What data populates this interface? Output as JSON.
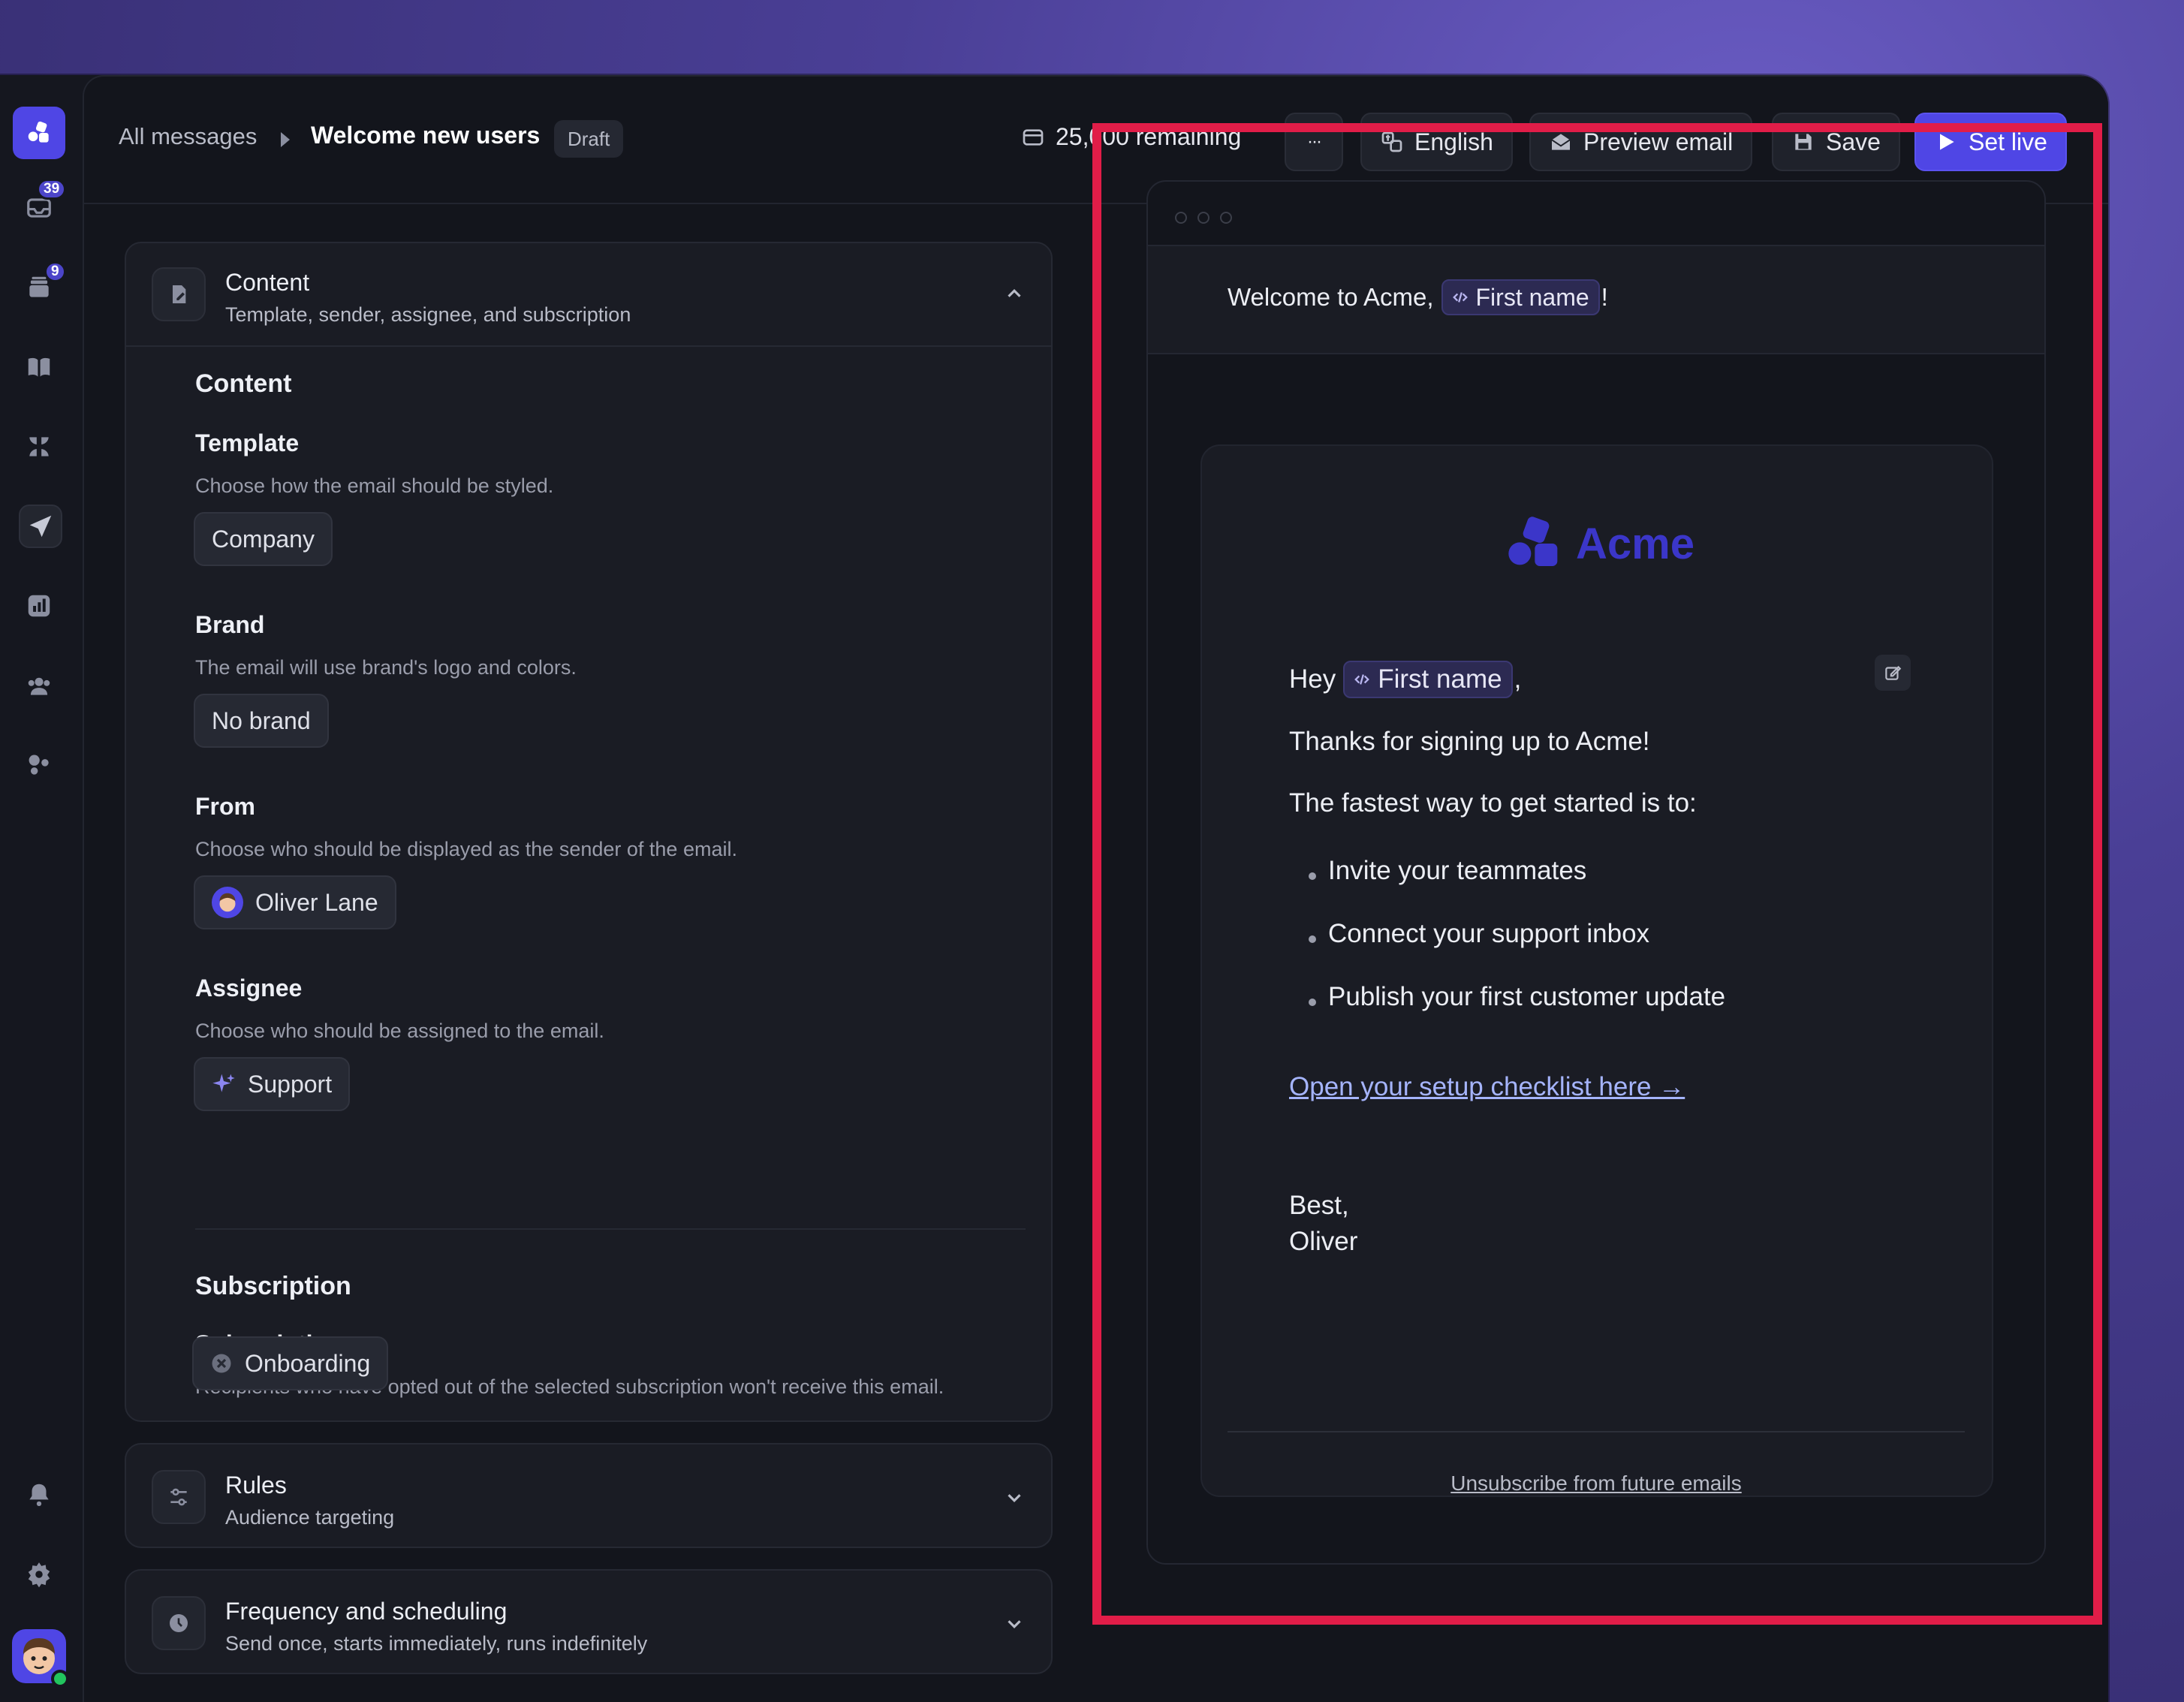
{
  "breadcrumb": {
    "parent": "All messages",
    "current": "Welcome new users",
    "status_badge": "Draft"
  },
  "toolbar": {
    "remaining": "25,000 remaining",
    "more_label": "···",
    "language_label": "English",
    "preview_label": "Preview email",
    "save_label": "Save",
    "set_live_label": "Set live"
  },
  "sidebar": {
    "inbox_badge": "39",
    "queue_badge": "9",
    "items": [
      "logo-icon",
      "inbox-icon",
      "archive-icon",
      "book-icon",
      "apps-icon",
      "send-icon",
      "reports-icon",
      "users-icon",
      "integrations-icon"
    ],
    "bottom": [
      "bell-icon",
      "gear-icon",
      "avatar"
    ]
  },
  "content_section": {
    "title": "Content",
    "subtitle": "Template, sender, assignee, and subscription",
    "heading": "Content",
    "template": {
      "label": "Template",
      "desc": "Choose how the email should be styled.",
      "value": "Company"
    },
    "brand": {
      "label": "Brand",
      "desc": "The email will use brand's logo and colors.",
      "value": "No brand"
    },
    "from": {
      "label": "From",
      "desc": "Choose who should be displayed as the sender of the email.",
      "value": "Oliver Lane"
    },
    "assignee": {
      "label": "Assignee",
      "desc": "Choose who should be assigned to the email.",
      "value": "Support"
    },
    "subscription_heading": "Subscription",
    "subscription": {
      "label": "Subscription",
      "desc": "Recipients who have opted out of the selected subscription won't receive this email.",
      "value": "Onboarding"
    }
  },
  "rules_section": {
    "title": "Rules",
    "subtitle": "Audience targeting"
  },
  "frequency_section": {
    "title": "Frequency and scheduling",
    "subtitle": "Send once, starts immediately, runs indefinitely"
  },
  "email_preview": {
    "subject_prefix": "Welcome to Acme,",
    "subject_variable": "First name",
    "subject_suffix": "!",
    "brand_name": "Acme",
    "greeting_prefix": "Hey",
    "greeting_variable": "First name",
    "greeting_suffix": ",",
    "line1": "Thanks for signing up to Acme!",
    "line2": "The fastest way to get started is to:",
    "bullets": [
      "Invite your teammates",
      "Connect your support inbox",
      "Publish your first customer update"
    ],
    "cta_link": "Open your setup checklist here →",
    "signoff": "Best,",
    "signature": "Oliver",
    "unsubscribe": "Unsubscribe from future emails"
  },
  "colors": {
    "accent": "#4f46e5",
    "brand": "#3b36c9",
    "highlight_border": "#e11d48",
    "link": "#a5b4fc"
  }
}
